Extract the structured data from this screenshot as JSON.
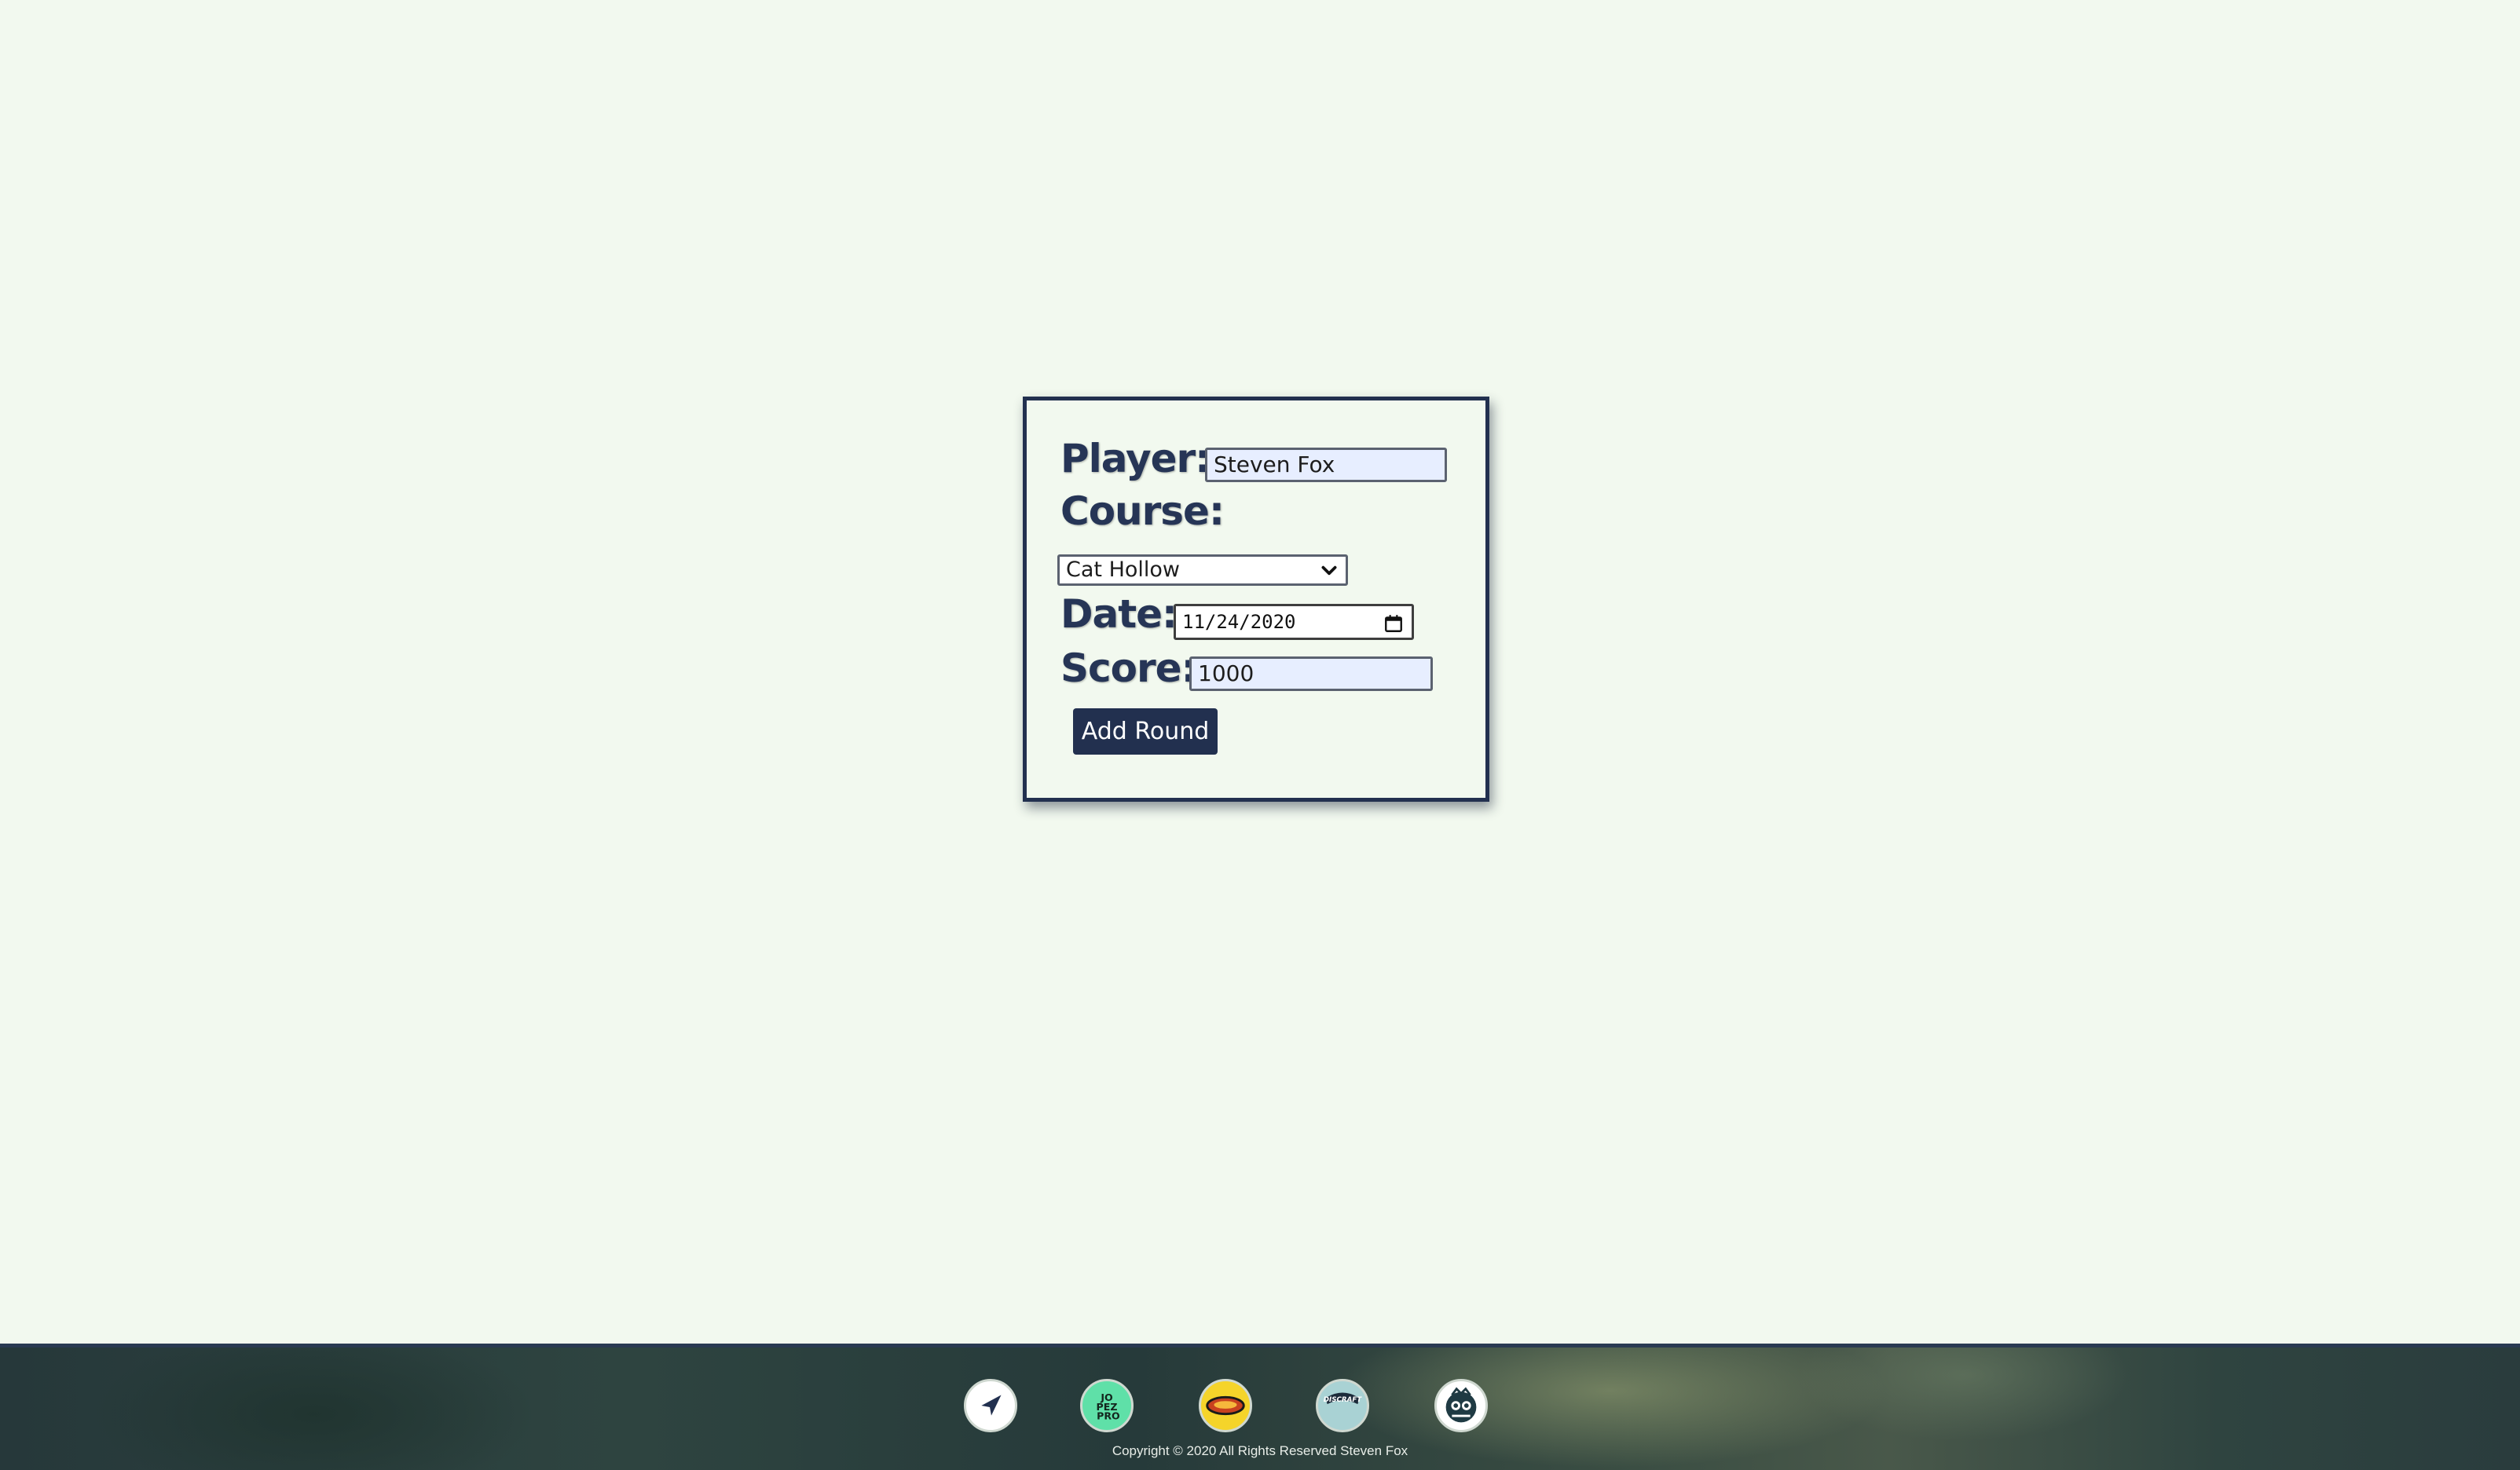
{
  "form": {
    "player_label": "Player:",
    "player_value": "Steven Fox",
    "course_label": "Course:",
    "course_selected": "Cat Hollow",
    "date_label": "Date:",
    "date_value": "11/24/2020",
    "score_label": "Score:",
    "score_value": "1000",
    "submit_label": "Add Round"
  },
  "footer": {
    "links": [
      {
        "name": "navigation-link",
        "icon": "location-arrow-icon",
        "color": "#ffffff"
      },
      {
        "name": "brand-link-1",
        "icon": "brand-logo-icon",
        "color": "#5fe0a8",
        "logo_text": "JO PEZ PRO"
      },
      {
        "name": "brand-link-2",
        "icon": "brand-logo-icon",
        "color": "#f5d42a"
      },
      {
        "name": "brand-link-3",
        "icon": "brand-logo-icon",
        "color": "#a9d2d4",
        "logo_text": "DISCRAFT"
      },
      {
        "name": "brand-link-4",
        "icon": "brand-logo-icon",
        "color": "#ffffff"
      }
    ],
    "copyright": "Copyright © 2020 All Rights Reserved Steven Fox"
  },
  "colors": {
    "background": "#f2f9ef",
    "primary": "#22304f",
    "label": "#263556",
    "input_bg": "#e7eeff"
  }
}
